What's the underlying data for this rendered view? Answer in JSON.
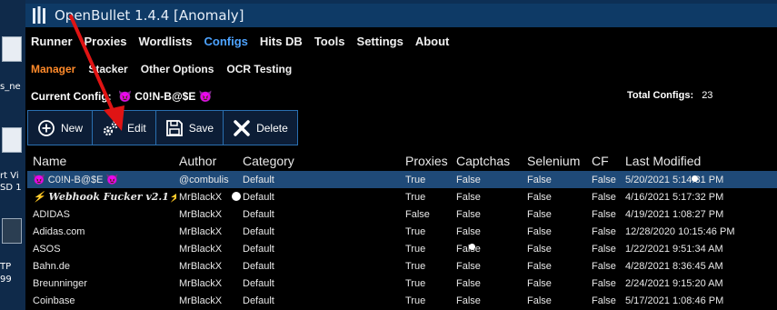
{
  "desktop": {
    "labels": [
      "s_ne",
      "rt Vi",
      "SD 1",
      "TP",
      "99"
    ]
  },
  "window": {
    "title": "OpenBullet 1.4.4 [Anomaly]"
  },
  "main_nav": [
    "Runner",
    "Proxies",
    "Wordlists",
    "Configs",
    "Hits DB",
    "Tools",
    "Settings",
    "About"
  ],
  "main_nav_active": "Configs",
  "sub_nav": [
    "Manager",
    "Stacker",
    "Other Options",
    "OCR Testing"
  ],
  "sub_nav_active": "Manager",
  "current_config": {
    "label": "Current Config:",
    "value": "😈 C0!N-B@$E 😈"
  },
  "total_configs": {
    "label": "Total Configs:",
    "value": "23"
  },
  "toolbar": {
    "new": "New",
    "edit": "Edit",
    "save": "Save",
    "delete": "Delete"
  },
  "grid": {
    "headers": [
      "Name",
      "Author",
      "Category",
      "Proxies",
      "Captchas",
      "Selenium",
      "CF",
      "Last Modified"
    ],
    "rows": [
      [
        "😈 C0!N-B@$E 😈",
        "@combulis",
        "Default",
        "True",
        "False",
        "False",
        "False",
        "5/20/2021 5:14:31 PM"
      ],
      [
        "⚡ Webhook Fucker v2.1⚡",
        "MrBlackX",
        "Default",
        "True",
        "False",
        "False",
        "False",
        "4/16/2021 5:17:32 PM"
      ],
      [
        "ADIDAS",
        "MrBlackX",
        "Default",
        "False",
        "False",
        "False",
        "False",
        "4/19/2021 1:08:27 PM"
      ],
      [
        "Adidas.com",
        "MrBlackX",
        "Default",
        "True",
        "False",
        "False",
        "False",
        "12/28/2020 10:15:46 PM"
      ],
      [
        "ASOS",
        "MrBlackX",
        "Default",
        "True",
        "False",
        "False",
        "False",
        "1/22/2021 9:51:34 AM"
      ],
      [
        "Bahn.de",
        "MrBlackX",
        "Default",
        "True",
        "False",
        "False",
        "False",
        "4/28/2021 8:36:45 AM"
      ],
      [
        "Breunninger",
        "MrBlackX",
        "Default",
        "True",
        "False",
        "False",
        "False",
        "2/24/2021 9:15:20 AM"
      ],
      [
        "Coinbase",
        "MrBlackX",
        "Default",
        "True",
        "False",
        "False",
        "False",
        "5/17/2021 1:08:46 PM"
      ]
    ],
    "selected_row": 0
  },
  "colors": {
    "titlebar": "#0e3a66",
    "nav_active": "#4da3ff",
    "subnav_active": "#ff8a2a",
    "selected_row": "#1f4a78",
    "arrow": "#e01414"
  },
  "icons": {
    "app": "bottles-icon",
    "new": "plus-circle-icon",
    "edit": "gears-icon",
    "save": "floppy-disk-icon",
    "delete": "x-icon"
  }
}
